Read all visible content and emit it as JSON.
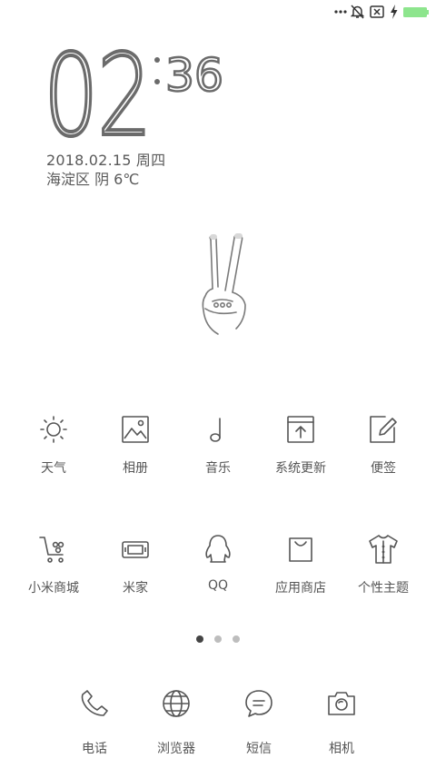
{
  "status_bar": {
    "icons": [
      "more-dots-icon",
      "bell-muted-icon",
      "close-box-icon",
      "charging-bolt-icon",
      "battery-icon"
    ],
    "battery_color": "#8de58d"
  },
  "lockscreen": {
    "hour": "02",
    "minute": "36",
    "date": "2018.02.15 周四",
    "weather": "海淀区 阴 6℃"
  },
  "apps_row1": [
    {
      "label": "天气",
      "icon": "sun-icon"
    },
    {
      "label": "相册",
      "icon": "image-icon"
    },
    {
      "label": "音乐",
      "icon": "music-note-icon"
    },
    {
      "label": "系统更新",
      "icon": "upload-icon"
    },
    {
      "label": "便签",
      "icon": "note-pen-icon"
    }
  ],
  "apps_row2": [
    {
      "label": "小米商城",
      "icon": "shopping-cart-icon"
    },
    {
      "label": "米家",
      "icon": "device-icon"
    },
    {
      "label": "QQ",
      "icon": "penguin-icon"
    },
    {
      "label": "应用商店",
      "icon": "shopping-bag-icon"
    },
    {
      "label": "个性主题",
      "icon": "shirt-icon"
    }
  ],
  "dock": [
    {
      "label": "电话",
      "icon": "phone-icon"
    },
    {
      "label": "浏览器",
      "icon": "globe-icon"
    },
    {
      "label": "短信",
      "icon": "message-icon"
    },
    {
      "label": "相机",
      "icon": "camera-icon"
    }
  ],
  "page_indicator": {
    "pages": 3,
    "active": 1
  }
}
